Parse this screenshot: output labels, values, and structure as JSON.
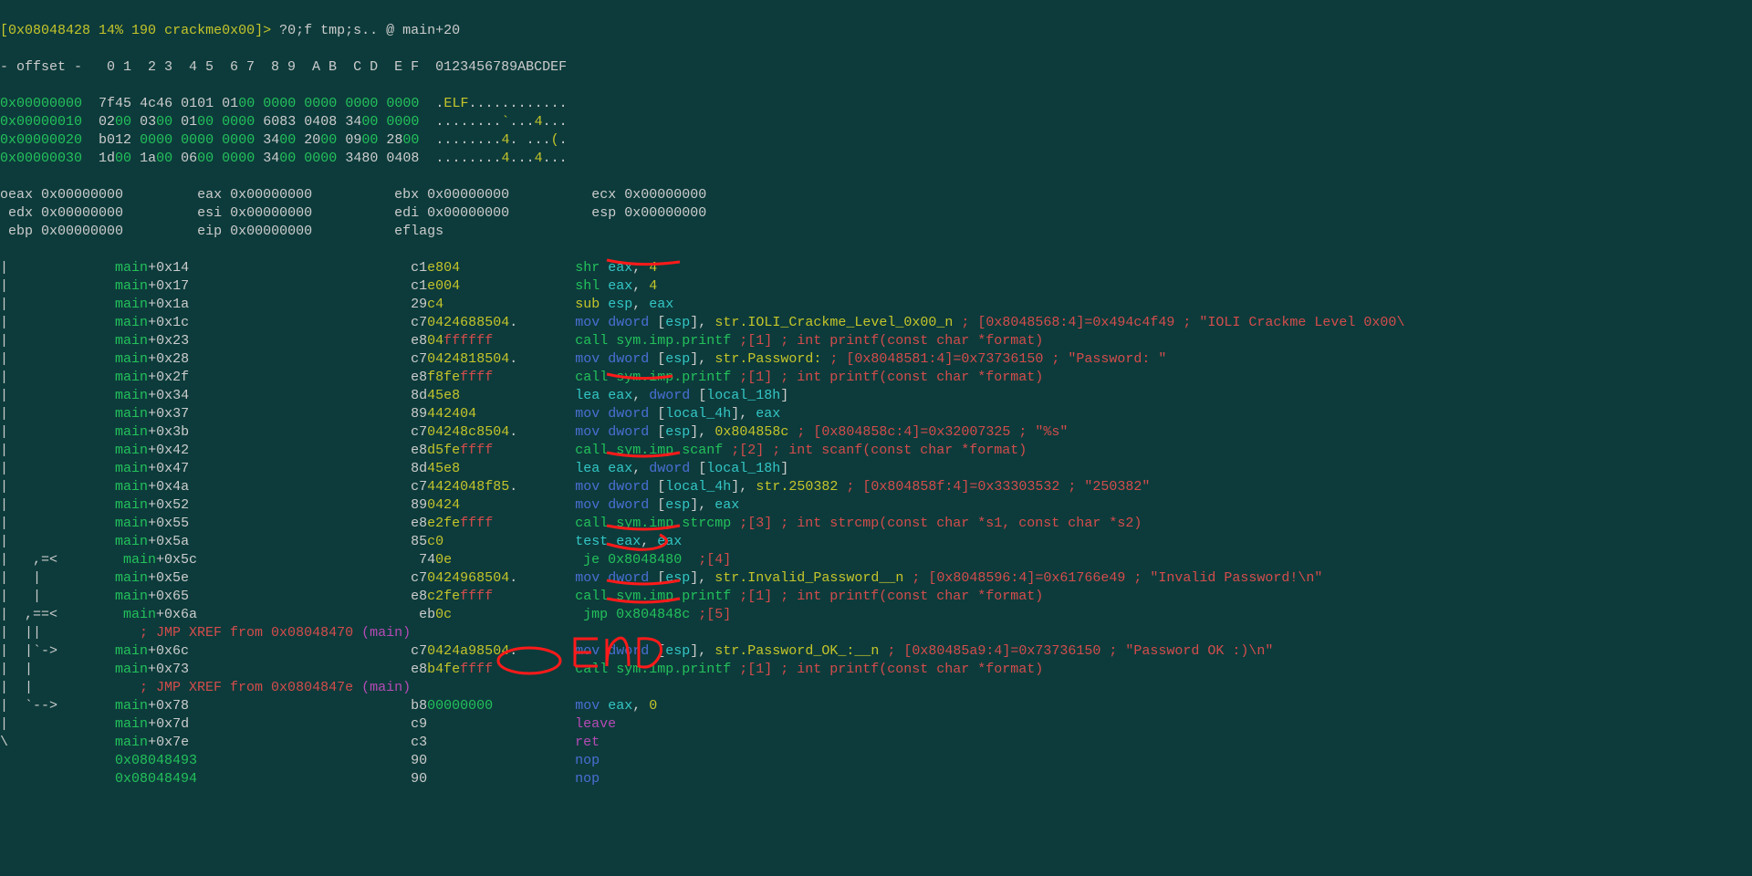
{
  "prompt": {
    "addr": "[0x08048428",
    "pct": " 14%",
    "num": " 190",
    "name": " crackme0x00]>",
    "cmd": " ?0;f tmp;s.. @ main+20"
  },
  "hexhdr": "- offset -   0 1  2 3  4 5  6 7  8 9  A B  C D  E F  0123456789ABCDEF",
  "hex": [
    {
      "addr": "0x00000000",
      "b": [
        "7f",
        "45",
        " 4c",
        "46",
        " 01",
        "01",
        " 01",
        "00",
        " 00",
        "00",
        " 00",
        "00",
        " 00",
        "00",
        " 00",
        "00"
      ],
      "asc": ".ELF............"
    },
    {
      "addr": "0x00000010",
      "b": [
        "02",
        "00",
        " 03",
        "00",
        " 01",
        "00",
        " 00",
        "00",
        " 60",
        "83",
        " 04",
        "08",
        " 34",
        "00",
        " 00",
        "00"
      ],
      "asc": "........`...4..."
    },
    {
      "addr": "0x00000020",
      "b": [
        "b0",
        "12",
        " 00",
        "00",
        " 00",
        "00",
        " 00",
        "00",
        " 34",
        "00",
        " 20",
        "00",
        " 09",
        "00",
        " 28",
        "00"
      ],
      "asc": "........4. ...(."
    },
    {
      "addr": "0x00000030",
      "b": [
        "1d",
        "00",
        " 1a",
        "00",
        " 06",
        "00",
        " 00",
        "00",
        " 34",
        "00",
        " 00",
        "00",
        " 34",
        "80",
        " 04",
        "08"
      ],
      "asc": "........4...4..."
    }
  ],
  "regs": [
    [
      [
        "oeax",
        "0x00000000"
      ],
      [
        "eax",
        "0x00000000"
      ],
      [
        "ebx",
        "0x00000000"
      ],
      [
        "ecx",
        "0x00000000"
      ]
    ],
    [
      [
        " edx",
        "0x00000000"
      ],
      [
        "esi",
        "0x00000000"
      ],
      [
        "edi",
        "0x00000000"
      ],
      [
        "esp",
        "0x00000000"
      ]
    ],
    [
      [
        " ebp",
        "0x00000000"
      ],
      [
        "eip",
        "0x00000000"
      ],
      [
        "eflags",
        ""
      ]
    ]
  ],
  "dis": [
    {
      "g": "|",
      "off": "main+0x14",
      "hex": "c1e804",
      "p": [
        [
          "gr",
          "shr"
        ],
        [
          "cy",
          " eax"
        ],
        [
          "wh",
          ","
        ],
        [
          "yl",
          " 4"
        ]
      ]
    },
    {
      "g": "|",
      "off": "main+0x17",
      "hex": "c1e004",
      "p": [
        [
          "gr",
          "shl"
        ],
        [
          "cy",
          " eax"
        ],
        [
          "wh",
          ","
        ],
        [
          "yl",
          " 4"
        ]
      ]
    },
    {
      "g": "|",
      "off": "main+0x1a",
      "hex": "29c4",
      "p": [
        [
          "yl",
          "sub"
        ],
        [
          "cy",
          " esp"
        ],
        [
          "wh",
          ","
        ],
        [
          "cy",
          " eax"
        ]
      ]
    },
    {
      "g": "|",
      "off": "main+0x1c",
      "hex": "c7042468 8504.",
      "p": [
        [
          "bl",
          "mov dword "
        ],
        [
          "wh",
          "["
        ],
        [
          "cy",
          "esp"
        ],
        [
          "wh",
          "], "
        ],
        [
          "yl",
          "str.IOLI_Crackme_Level_0x00_n"
        ],
        [
          "rd",
          " ; [0x8048568:4]=0x494c4f49 ; \"IOLI Crackme Level 0x00\\"
        ]
      ],
      "hx": "c70424688504."
    },
    {
      "g": "|",
      "off": "main+0x23",
      "hex": "e804ffffff",
      "p": [
        [
          "gr",
          "call sym.imp.printf"
        ],
        [
          "rd",
          " ;[1] ; int printf(const char *format)"
        ]
      ]
    },
    {
      "g": "|",
      "off": "main+0x28",
      "hex": "c70424818504.",
      "p": [
        [
          "bl",
          "mov dword "
        ],
        [
          "wh",
          "["
        ],
        [
          "cy",
          "esp"
        ],
        [
          "wh",
          "], "
        ],
        [
          "yl",
          "str.Password:"
        ],
        [
          "rd",
          " ; [0x8048581:4]=0x73736150 ; \"Password: \""
        ]
      ]
    },
    {
      "g": "|",
      "off": "main+0x2f",
      "hex": "e8f8feffff",
      "p": [
        [
          "gr",
          "call sym.imp.printf"
        ],
        [
          "rd",
          " ;[1] ; int printf(const char *format)"
        ]
      ]
    },
    {
      "g": "|",
      "off": "main+0x34",
      "hex": "8d45e8",
      "p": [
        [
          "cy",
          "lea"
        ],
        [
          "cy",
          " eax"
        ],
        [
          "wh",
          ", "
        ],
        [
          "bl",
          "dword "
        ],
        [
          "wh",
          "["
        ],
        [
          "cy",
          "local_18h"
        ],
        [
          "wh",
          "]"
        ]
      ]
    },
    {
      "g": "|",
      "off": "main+0x37",
      "hex": "89442404",
      "p": [
        [
          "bl",
          "mov dword "
        ],
        [
          "wh",
          "["
        ],
        [
          "cy",
          "local_4h"
        ],
        [
          "wh",
          "], "
        ],
        [
          "cy",
          "eax"
        ]
      ]
    },
    {
      "g": "|",
      "off": "main+0x3b",
      "hex": "c704248c8504.",
      "p": [
        [
          "bl",
          "mov dword "
        ],
        [
          "wh",
          "["
        ],
        [
          "cy",
          "esp"
        ],
        [
          "wh",
          "], "
        ],
        [
          "yl",
          "0x804858c"
        ],
        [
          "rd",
          " ; [0x804858c:4]=0x32007325 ; \"%s\""
        ]
      ]
    },
    {
      "g": "|",
      "off": "main+0x42",
      "hex": "e8d5feffff",
      "p": [
        [
          "gr",
          "call sym.imp.scanf"
        ],
        [
          "rd",
          " ;[2] ; int scanf(const char *format)"
        ]
      ]
    },
    {
      "g": "|",
      "off": "main+0x47",
      "hex": "8d45e8",
      "p": [
        [
          "cy",
          "lea"
        ],
        [
          "cy",
          " eax"
        ],
        [
          "wh",
          ", "
        ],
        [
          "bl",
          "dword "
        ],
        [
          "wh",
          "["
        ],
        [
          "cy",
          "local_18h"
        ],
        [
          "wh",
          "]"
        ]
      ]
    },
    {
      "g": "|",
      "off": "main+0x4a",
      "hex": "c744240 48f85.",
      "p": [
        [
          "bl",
          "mov dword "
        ],
        [
          "wh",
          "["
        ],
        [
          "cy",
          "local_4h"
        ],
        [
          "wh",
          "], "
        ],
        [
          "yl",
          "str.250382"
        ],
        [
          "rd",
          " ; [0x804858f:4]=0x33303532 ; \"250382\""
        ]
      ],
      "hx": "c74424048f85."
    },
    {
      "g": "|",
      "off": "main+0x52",
      "hex": "890424",
      "p": [
        [
          "bl",
          "mov dword "
        ],
        [
          "wh",
          "["
        ],
        [
          "cy",
          "esp"
        ],
        [
          "wh",
          "], "
        ],
        [
          "cy",
          "eax"
        ]
      ]
    },
    {
      "g": "|",
      "off": "main+0x55",
      "hex": "e8e2feffff",
      "p": [
        [
          "gr",
          "call sym.imp.strcmp"
        ],
        [
          "rd",
          " ;[3] ; int strcmp(const char *s1, const char *s2)"
        ]
      ]
    },
    {
      "g": "|",
      "off": "main+0x5a",
      "hex": "85c0",
      "p": [
        [
          "cy",
          "test"
        ],
        [
          "cy",
          " eax"
        ],
        [
          "wh",
          ","
        ],
        [
          "cy",
          " eax"
        ]
      ]
    },
    {
      "g": "|   ,=<",
      "off": "main+0x5c",
      "hex": "740e",
      "p": [
        [
          "gr",
          "je 0x8048480"
        ],
        [
          "rd",
          "  ;[4]"
        ]
      ]
    },
    {
      "g": "|   |",
      "off": "main+0x5e",
      "hex": "c70424968504.",
      "p": [
        [
          "bl",
          "mov dword "
        ],
        [
          "wh",
          "["
        ],
        [
          "cy",
          "esp"
        ],
        [
          "wh",
          "], "
        ],
        [
          "yl",
          "str.Invalid_Password__n"
        ],
        [
          "rd",
          " ; [0x8048596:4]=0x61766e49 ; \"Invalid Password!\\n\""
        ]
      ]
    },
    {
      "g": "|   |",
      "off": "main+0x65",
      "hex": "e8c2feffff",
      "p": [
        [
          "gr",
          "call sym.imp.printf"
        ],
        [
          "rd",
          " ;[1] ; int printf(const char *format)"
        ]
      ]
    },
    {
      "g": "|  ,==<",
      "off": "main+0x6a",
      "hex": "eb0c",
      "p": [
        [
          "gr",
          "jmp 0x804848c"
        ],
        [
          "rd",
          " ;[5]"
        ]
      ]
    },
    {
      "g": "|  ||",
      "xref": "; JMP XREF from 0x08048470",
      "xrefname": " (main)"
    },
    {
      "g": "|  |`->",
      "off": "main+0x6c",
      "hex": "c70424a98504.",
      "p": [
        [
          "bl",
          "mov dword "
        ],
        [
          "wh",
          "["
        ],
        [
          "cy",
          "esp"
        ],
        [
          "wh",
          "], "
        ],
        [
          "yl",
          "str.Password_OK_:__n"
        ],
        [
          "rd",
          " ; [0x80485a9:4]=0x73736150 ; \"Password OK :)\\n\""
        ]
      ]
    },
    {
      "g": "|  |",
      "off": "main+0x73",
      "hex": "e8b4feffff",
      "p": [
        [
          "gr",
          "call sym.imp.printf"
        ],
        [
          "rd",
          " ;[1] ; int printf(const char *format)"
        ]
      ]
    },
    {
      "g": "|  |",
      "xref": "; JMP XREF from 0x0804847e",
      "xrefname": " (main)"
    },
    {
      "g": "|  `-->",
      "off": "main+0x78",
      "hex": "b800000000",
      "p": [
        [
          "bl",
          "mov "
        ],
        [
          "cy",
          "eax"
        ],
        [
          "wh",
          ", "
        ],
        [
          "yl",
          "0"
        ]
      ]
    },
    {
      "g": "|",
      "off": "main+0x7d",
      "hex": "c9",
      "p": [
        [
          "mag",
          "leave"
        ]
      ]
    },
    {
      "g": "\\",
      "off": "main+0x7e",
      "hex": "c3",
      "p": [
        [
          "mag",
          "ret"
        ]
      ]
    },
    {
      "addr": "0x08048493",
      "hex": "90",
      "p": [
        [
          "bl",
          "nop"
        ]
      ]
    },
    {
      "addr": "0x08048494",
      "hex": "90",
      "p": [
        [
          "bl",
          "nop"
        ]
      ]
    }
  ],
  "end_label": "END"
}
